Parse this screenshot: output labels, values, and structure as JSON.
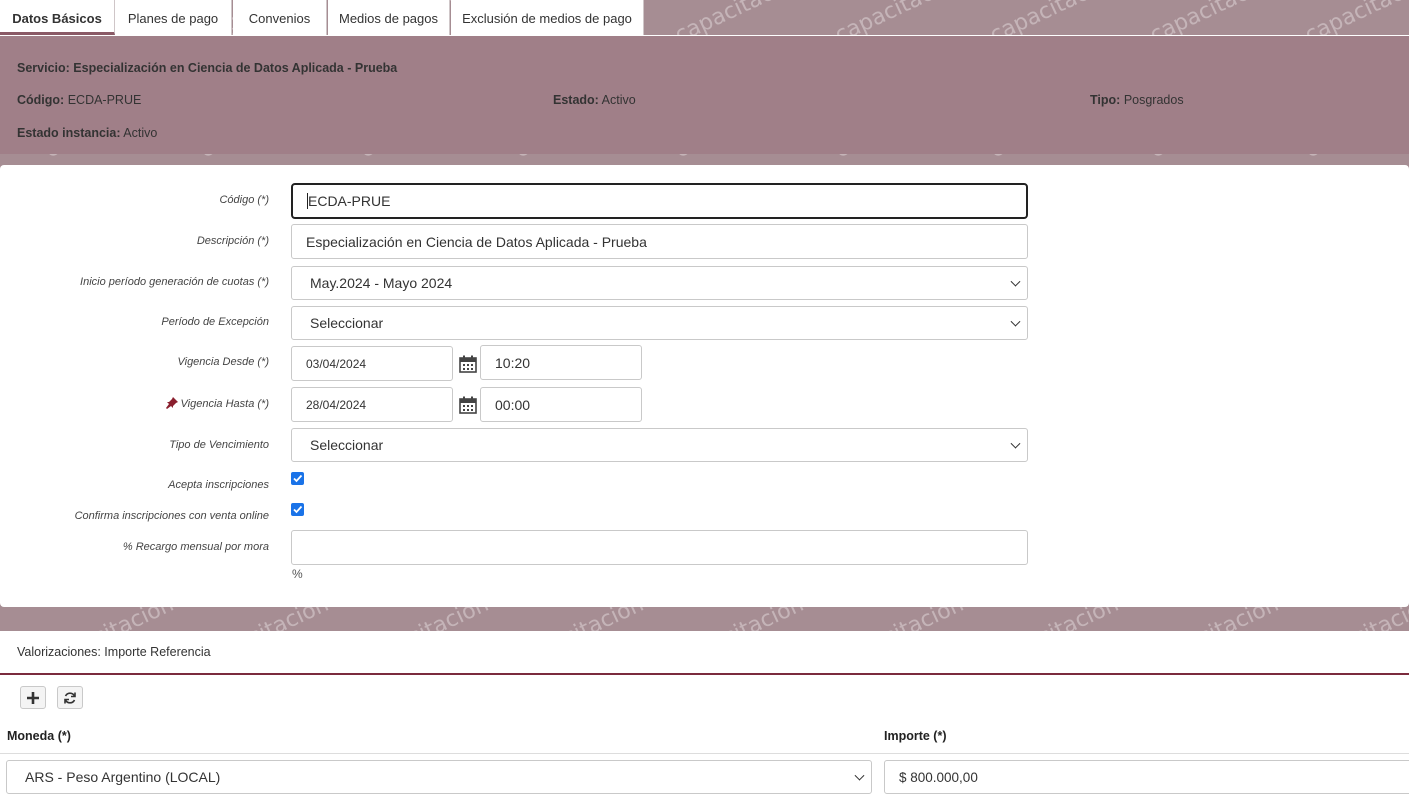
{
  "tabs": [
    {
      "label": "Datos Básicos",
      "active": true
    },
    {
      "label": "Planes de pago"
    },
    {
      "label": "Convenios"
    },
    {
      "label": "Medios de pagos"
    },
    {
      "label": "Exclusión de medios de pago"
    }
  ],
  "watermark": "capacitación",
  "info": {
    "servicio_label": "Servicio:",
    "servicio_value": "Especialización en Ciencia de Datos Aplicada - Prueba",
    "codigo_label": "Código:",
    "codigo_value": "ECDA-PRUE",
    "estado_label": "Estado:",
    "estado_value": "Activo",
    "tipo_label": "Tipo:",
    "tipo_value": "Posgrados",
    "estado_instancia_label": "Estado instancia:",
    "estado_instancia_value": "Activo"
  },
  "form": {
    "codigo_label": "Código (*)",
    "codigo_value": "ECDA-PRUE",
    "descripcion_label": "Descripción (*)",
    "descripcion_value": "Especialización en Ciencia de Datos Aplicada - Prueba",
    "inicio_label": "Inicio período generación de cuotas (*)",
    "inicio_value": "May.2024 - Mayo 2024",
    "excepcion_label": "Período de Excepción",
    "excepcion_value": "Seleccionar",
    "desde_label": "Vigencia Desde (*)",
    "desde_date": "03/04/2024",
    "desde_time": "10:20",
    "hasta_label": "Vigencia Hasta (*)",
    "hasta_date": "28/04/2024",
    "hasta_time": "00:00",
    "vencimiento_label": "Tipo de Vencimiento",
    "vencimiento_value": "Seleccionar",
    "acepta_label": "Acepta inscripciones",
    "acepta_checked": true,
    "confirma_label": "Confirma inscripciones con venta online",
    "confirma_checked": true,
    "recargo_label": "% Recargo mensual por mora",
    "recargo_value": "",
    "recargo_unit": "%"
  },
  "valorizaciones": {
    "title": "Valorizaciones: Importe Referencia",
    "col_moneda": "Moneda (*)",
    "col_importe": "Importe (*)",
    "moneda_value": "ARS - Peso Argentino (LOCAL)",
    "importe_value": "$ 800.000,00"
  },
  "colors": {
    "accent": "#7b2b3d",
    "checkbox": "#1a73e8",
    "band": "#a07f88"
  }
}
